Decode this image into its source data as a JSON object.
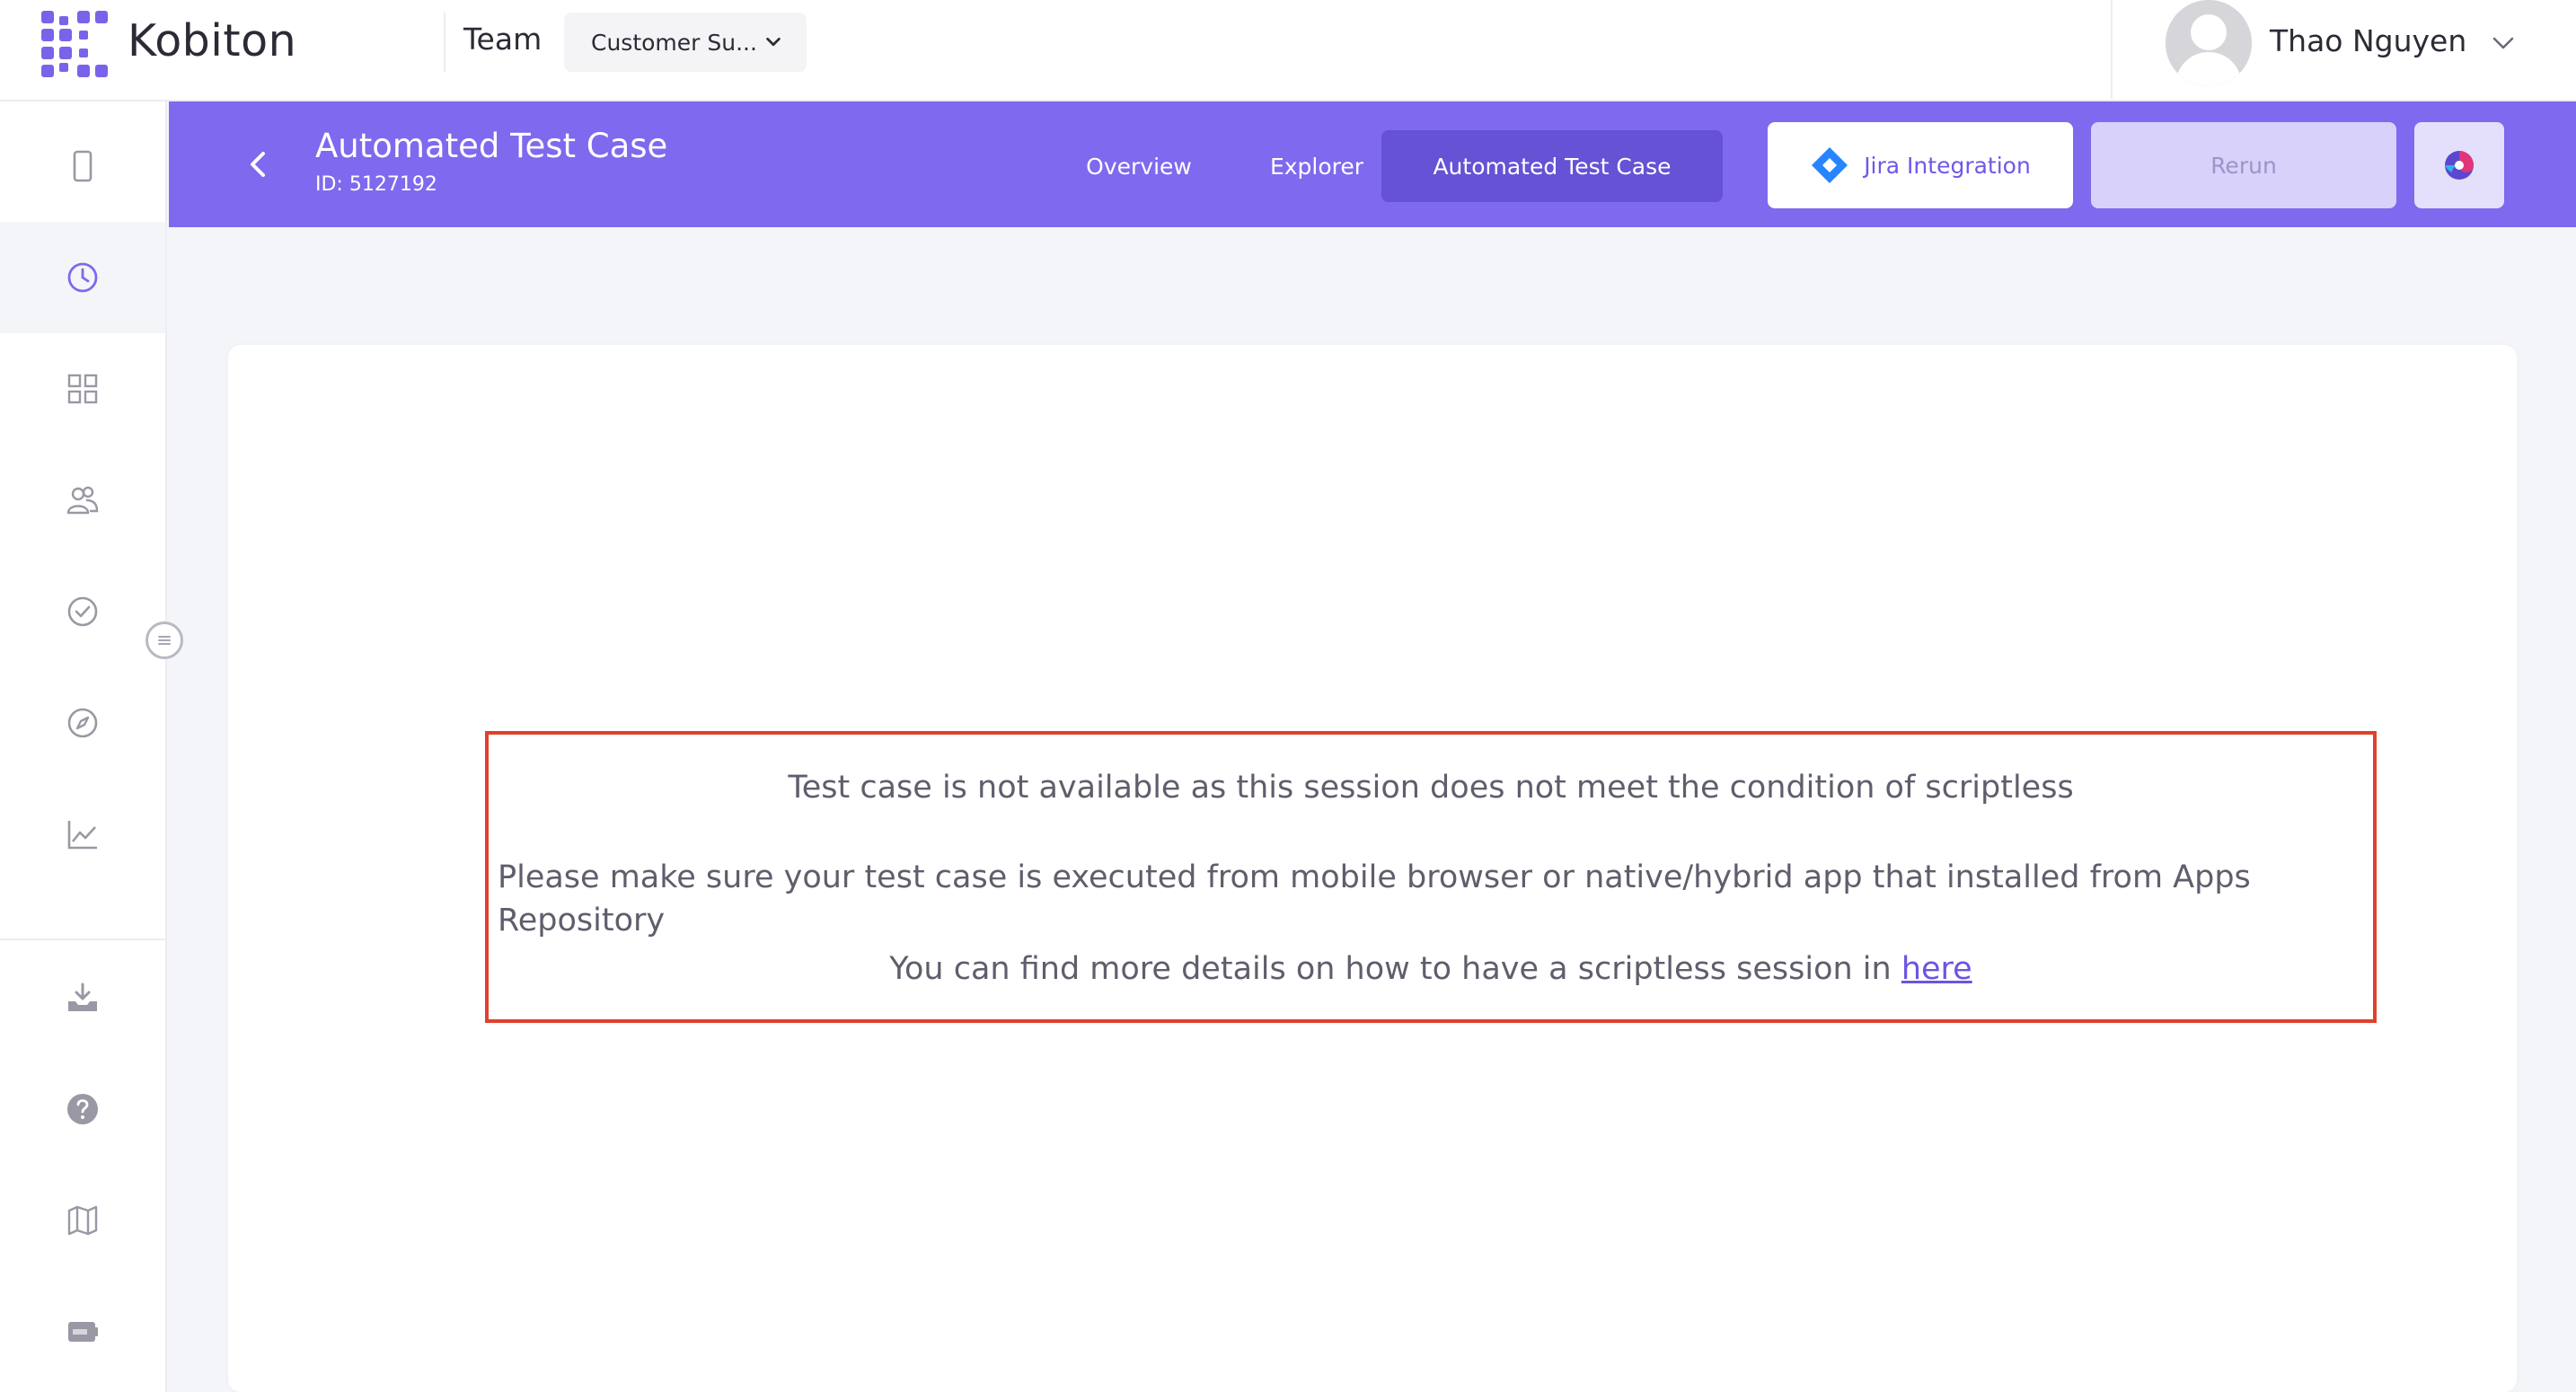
{
  "brand": {
    "name": "Kobiton",
    "accent": "#7f69ee"
  },
  "topbar": {
    "team_label": "Team",
    "team_select_value": "Customer Su...",
    "user_name": "Thao Nguyen"
  },
  "sidebar": {
    "items": [
      {
        "name": "devices",
        "icon": "mobile-device-icon",
        "active": false
      },
      {
        "name": "sessions",
        "icon": "clock-icon",
        "active": true
      },
      {
        "name": "apps",
        "icon": "grid-icon",
        "active": false
      },
      {
        "name": "team",
        "icon": "users-icon",
        "active": false
      },
      {
        "name": "test-runs",
        "icon": "check-circle-icon",
        "active": false
      },
      {
        "name": "explorer",
        "icon": "compass-icon",
        "active": false
      },
      {
        "name": "analytics",
        "icon": "chart-icon",
        "active": false
      },
      {
        "name": "download",
        "icon": "download-tray-icon",
        "active": false
      },
      {
        "name": "help",
        "icon": "question-icon",
        "active": false
      },
      {
        "name": "map",
        "icon": "map-icon",
        "active": false
      },
      {
        "name": "api",
        "icon": "api-card-icon",
        "active": false
      }
    ]
  },
  "subheader": {
    "title": "Automated Test Case",
    "id_text": "ID: 5127192",
    "tabs": [
      {
        "label": "Overview",
        "active": false
      },
      {
        "label": "Explorer",
        "active": false
      },
      {
        "label": "Automated Test Case",
        "active": true
      }
    ],
    "jira_label": "Jira Integration",
    "rerun_label": "Rerun"
  },
  "notice": {
    "line1": "Test case is not available as this session does not meet the condition of scriptless",
    "line2": "Please make sure your test case is executed from mobile browser or native/hybrid app that installed from Apps Repository",
    "line3_prefix": "You can find more details on how to have a scriptless session in ",
    "line3_link": "here",
    "border_color": "#e0402c"
  }
}
